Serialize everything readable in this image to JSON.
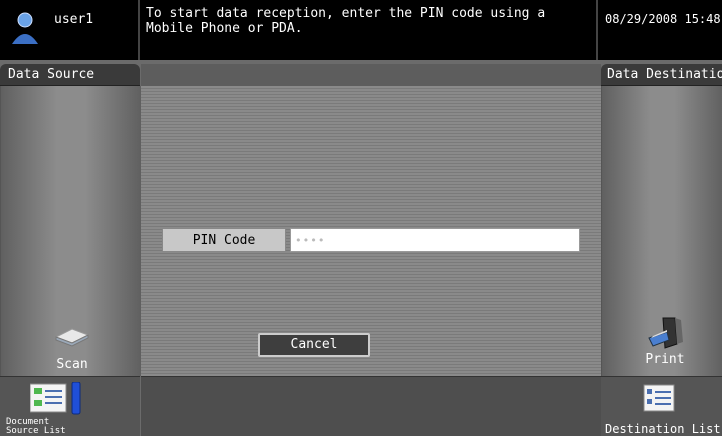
{
  "header": {
    "user_name": "user1",
    "message": "To start data reception, enter the PIN code using a Mobile Phone or PDA.",
    "datetime": "08/29/2008  15:48"
  },
  "left_panel": {
    "title": "Data Source",
    "scan_label": "Scan",
    "doc_list_label": "Document Source List"
  },
  "right_panel": {
    "title": "Data Destination",
    "print_label": "Print",
    "dest_list_label": "Destination List"
  },
  "pin": {
    "label": "PIN Code",
    "value": "••••"
  },
  "buttons": {
    "cancel": "Cancel"
  }
}
